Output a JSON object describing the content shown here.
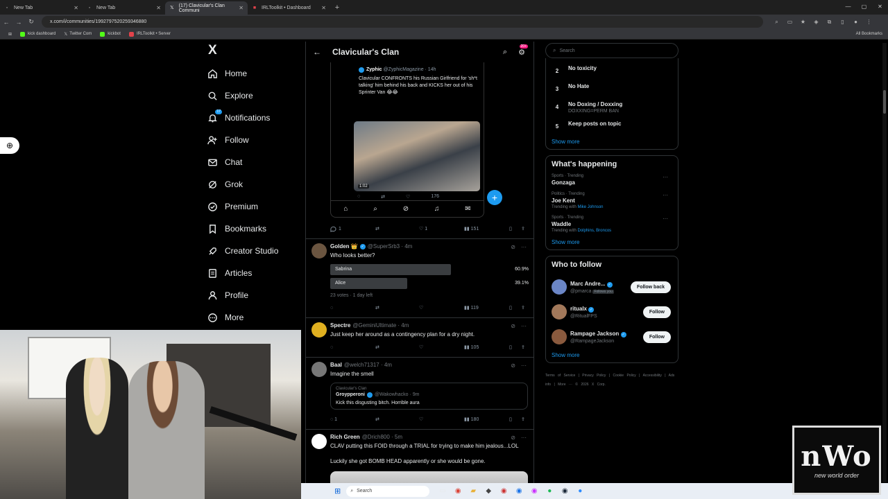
{
  "browser": {
    "tabs": [
      {
        "title": "New Tab",
        "active": false
      },
      {
        "title": "New Tab",
        "active": false
      },
      {
        "title": "(17) Clavicular's Clan Communi",
        "active": true
      },
      {
        "title": "IRLToolkit • Dashboard",
        "active": false
      }
    ],
    "url": "x.com/i/communities/1992797520259346880",
    "bookmarks": [
      "kick dashboard",
      "Twitter Com",
      "kickbot",
      "IRLToolkit • Server"
    ],
    "all_bookmarks": "All Bookmarks"
  },
  "nav": {
    "logo": "X",
    "notifications_badge": "17",
    "items": [
      {
        "label": "Home",
        "icon": "home-icon"
      },
      {
        "label": "Explore",
        "icon": "search-icon"
      },
      {
        "label": "Notifications",
        "icon": "bell-icon"
      },
      {
        "label": "Follow",
        "icon": "person-add-icon"
      },
      {
        "label": "Chat",
        "icon": "mail-icon"
      },
      {
        "label": "Grok",
        "icon": "grok-icon"
      },
      {
        "label": "Premium",
        "icon": "verified-icon"
      },
      {
        "label": "Bookmarks",
        "icon": "bookmark-icon"
      },
      {
        "label": "Creator Studio",
        "icon": "rocket-icon"
      },
      {
        "label": "Articles",
        "icon": "article-icon"
      },
      {
        "label": "Profile",
        "icon": "person-icon"
      },
      {
        "label": "More",
        "icon": "more-circle-icon"
      }
    ]
  },
  "main": {
    "title": "Clavicular's Clan",
    "notif_badge": "20+",
    "embedded": {
      "name": "Zyphic",
      "handle": "@ZyphicMagazine · 14h",
      "text": "Clavicular CONFRONTS his Russian Girlfriend for 'sh*t talking' him behind his back and KICKS her out of his Sprinter Van 😂😂",
      "duration": "1:02",
      "views": "176"
    },
    "first_actions": {
      "replies": "1",
      "likes": "1",
      "views": "151"
    },
    "posts": [
      {
        "name": "Golden 👑",
        "handle": "@SuperSrb3 · 4m",
        "text": "Who looks better?",
        "poll": [
          {
            "label": "Sabrina",
            "pct": "60.9%",
            "value": 0.609
          },
          {
            "label": "Alice",
            "pct": "39.1%",
            "value": 0.391
          }
        ],
        "poll_meta": "23 votes · 1 day left",
        "views": "119"
      },
      {
        "name": "Spectre",
        "handle": "@GeminiUltimate · 4m",
        "text": "Just keep her around as a contingency plan for a dry night.",
        "views": "105"
      },
      {
        "name": "Baal",
        "handle": "@welch71317 · 4m",
        "text": "Imagine the smell",
        "quote": {
          "community": "Clavicular's Clan",
          "name": "Groypperoni",
          "handle": "@Wakowhacko · 9m",
          "text": "Kick this disgusting bitch. Horrible aura"
        },
        "replies": "1",
        "views": "180"
      },
      {
        "name": "Rich Green",
        "handle": "@Drich800 · 5m",
        "text": "CLAV putting this FOID through a TRIAL for trying to make him jealous...LOL",
        "text2": "Luckily she got BOMB HEAD apparently or she would be gone."
      }
    ]
  },
  "right": {
    "search_placeholder": "Search",
    "rules": [
      {
        "num": "2",
        "title": "No toxicity",
        "sub": ""
      },
      {
        "num": "3",
        "title": "No Hate",
        "sub": ""
      },
      {
        "num": "4",
        "title": "No Doxing / Doxxing",
        "sub": "DOXXING=PERM BAN"
      },
      {
        "num": "5",
        "title": "Keep posts on topic",
        "sub": ""
      }
    ],
    "show_more": "Show more",
    "happening": {
      "title": "What's happening",
      "trends": [
        {
          "cat": "Sports · Trending",
          "name": "Gonzaga",
          "with_label": "",
          "with": ""
        },
        {
          "cat": "Politics · Trending",
          "name": "Joe Kent",
          "with_label": "Trending with",
          "with": "Mike Johnson"
        },
        {
          "cat": "Sports · Trending",
          "name": "Waddle",
          "with_label": "Trending with",
          "with": "Dolphins, Broncos"
        }
      ]
    },
    "who_to_follow": {
      "title": "Who to follow",
      "accounts": [
        {
          "name": "Marc Andre...",
          "handle": "@pmarca",
          "follows_you": "Follows you",
          "button": "Follow back",
          "color": "#6b86c6"
        },
        {
          "name": "ritualx",
          "handle": "@RitualFPS",
          "follows_you": "",
          "button": "Follow",
          "color": "#a2785a"
        },
        {
          "name": "Rampage Jackson",
          "handle": "@RampageJackson",
          "follows_you": "",
          "button": "Follow",
          "color": "#8a5a3e"
        }
      ]
    },
    "footer": "Terms of Service | Privacy Policy | Cookie Policy | Accessibility | Ads info | More ··· © 2026 X Corp."
  },
  "taskbar": {
    "search": "Search"
  },
  "overlay": {
    "logo_big": "nWo",
    "logo_small": "new world order"
  }
}
